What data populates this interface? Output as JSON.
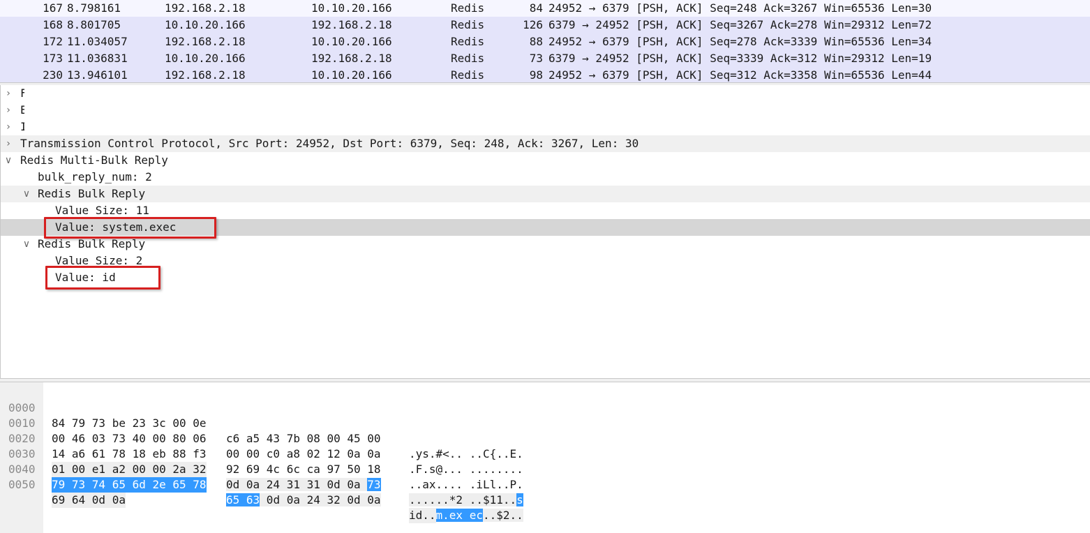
{
  "packet_list": {
    "rows": [
      {
        "no": "167",
        "time": "8.798161",
        "src": "192.168.2.18",
        "dst": "10.10.20.166",
        "proto": "Redis",
        "len": "84",
        "info": "24952 → 6379 [PSH, ACK] Seq=248 Ack=3267 Win=65536 Len=30"
      },
      {
        "no": "168",
        "time": "8.801705",
        "src": "10.10.20.166",
        "dst": "192.168.2.18",
        "proto": "Redis",
        "len": "126",
        "info": "6379 → 24952 [PSH, ACK] Seq=3267 Ack=278 Win=29312 Len=72"
      },
      {
        "no": "172",
        "time": "11.034057",
        "src": "192.168.2.18",
        "dst": "10.10.20.166",
        "proto": "Redis",
        "len": "88",
        "info": "24952 → 6379 [PSH, ACK] Seq=278 Ack=3339 Win=65536 Len=34"
      },
      {
        "no": "173",
        "time": "11.036831",
        "src": "10.10.20.166",
        "dst": "192.168.2.18",
        "proto": "Redis",
        "len": "73",
        "info": "6379 → 24952 [PSH, ACK] Seq=3339 Ack=312 Win=29312 Len=19"
      },
      {
        "no": "230",
        "time": "13.946101",
        "src": "192.168.2.18",
        "dst": "10.10.20.166",
        "proto": "Redis",
        "len": "98",
        "info": "24952 → 6379 [PSH, ACK] Seq=312 Ack=3358 Win=65536 Len=44"
      }
    ]
  },
  "details": {
    "collapsed_prefixes": [
      "F",
      "E",
      "I"
    ],
    "tcp_line": "Transmission Control Protocol, Src Port: 24952, Dst Port: 6379, Seq: 248, Ack: 3267, Len: 30",
    "redis_title": "Redis Multi-Bulk Reply",
    "bulk_reply_num": "bulk_reply_num: 2",
    "bulk1_title": "Redis Bulk Reply",
    "bulk1_size": "Value Size: 11",
    "bulk1_value": "Value: system.exec",
    "bulk2_title": "Redis Bulk Reply",
    "bulk2_size": "Value Size: 2",
    "bulk2_value": "Value: id"
  },
  "hex": {
    "rows": [
      {
        "off": "0000",
        "a": "84 79 73 be 23 3c 00 0e",
        "b": "c6 a5 43 7b 08 00 45 00",
        "asc": ".ys.#<.. ..C{..E."
      },
      {
        "off": "0010",
        "a": "00 46 03 73 40 00 80 06",
        "b": "00 00 c0 a8 02 12 0a 0a",
        "asc": ".F.s@... ........"
      },
      {
        "off": "0020",
        "a": "14 a6 61 78 18 eb 88 f3",
        "b": "92 69 4c 6c ca 97 50 18",
        "asc": "..ax.... .iLl..P."
      },
      {
        "off": "0030",
        "a": "01 00 e1 a2 00 00 2a 32",
        "b_plain": "0d 0a 24 31 31 0d 0a ",
        "b_sel": "73",
        "asc_plain": "......*2 ..$11..",
        "asc_sel": "s"
      },
      {
        "off": "0040",
        "a_sel": "79 73 74 65 6d 2e 65 78",
        "b_sel": "65 63",
        "b_plain": " 0d 0a 24 32 0d 0a",
        "asc_sel": "ystem.ex ec",
        "asc_plain": "..$2.."
      },
      {
        "off": "0050",
        "a": "69 64 0d 0a",
        "asc": "id.."
      }
    ]
  }
}
